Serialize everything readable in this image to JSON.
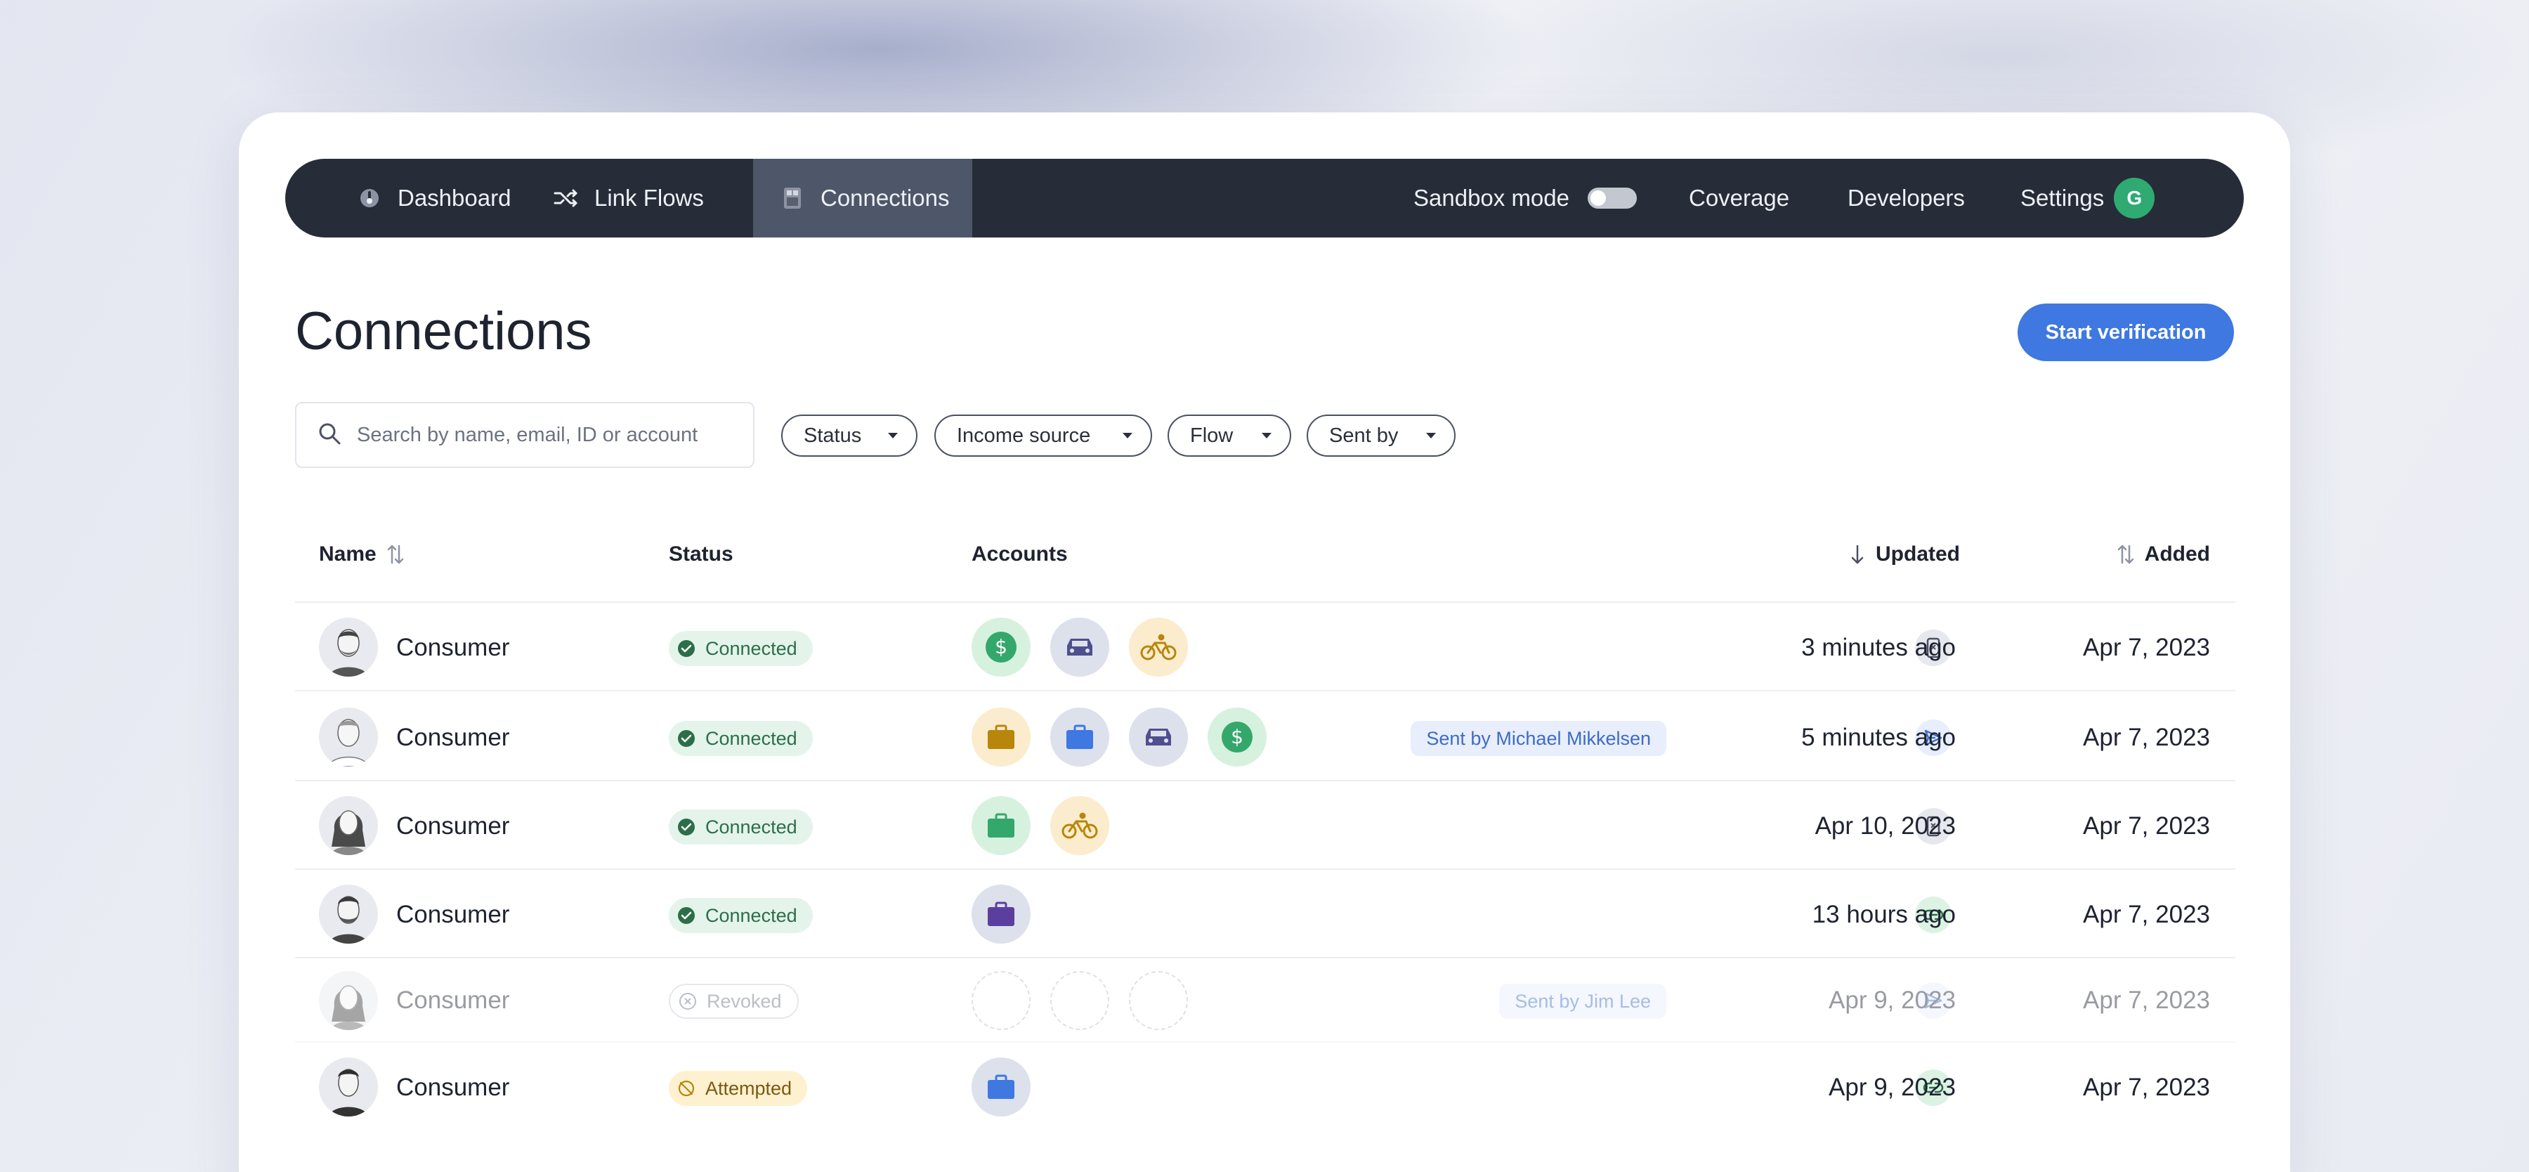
{
  "nav": {
    "dashboard": "Dashboard",
    "link_flows": "Link Flows",
    "connections": "Connections",
    "sandbox": "Sandbox mode",
    "coverage": "Coverage",
    "developers": "Developers",
    "settings": "Settings",
    "avatar_initial": "G"
  },
  "page": {
    "title": "Connections",
    "start_button": "Start verification"
  },
  "search": {
    "placeholder": "Search by name, email, ID or account"
  },
  "filters": {
    "status": "Status",
    "income_source": "Income source",
    "flow": "Flow",
    "sent_by": "Sent by"
  },
  "table": {
    "headers": {
      "name": "Name",
      "status": "Status",
      "accounts": "Accounts",
      "updated": "Updated",
      "added": "Added"
    },
    "rows": [
      {
        "name": "Consumer",
        "status": "Connected",
        "accounts": [
          "dollar-icon",
          "car-icon",
          "bike-icon"
        ],
        "sent_by": "",
        "method": "phone-icon",
        "updated": "3 minutes ago",
        "added": "Apr 7, 2023"
      },
      {
        "name": "Consumer",
        "status": "Connected",
        "accounts": [
          "briefcase-icon",
          "briefcase-icon",
          "car-icon",
          "dollar-icon"
        ],
        "sent_by": "Sent by Michael Mikkelsen",
        "method": "send-icon",
        "updated": "5 minutes ago",
        "added": "Apr 7, 2023"
      },
      {
        "name": "Consumer",
        "status": "Connected",
        "accounts": [
          "briefcase-icon",
          "bike-icon"
        ],
        "sent_by": "",
        "method": "phone-icon",
        "updated": "Apr 10, 2023",
        "added": "Apr 7, 2023"
      },
      {
        "name": "Consumer",
        "status": "Connected",
        "accounts": [
          "briefcase-icon"
        ],
        "sent_by": "",
        "method": "link-icon",
        "updated": "13 hours ago",
        "added": "Apr 7, 2023"
      },
      {
        "name": "Consumer",
        "status": "Revoked",
        "accounts": [
          "empty",
          "empty",
          "empty"
        ],
        "sent_by": "Sent by Jim Lee",
        "method": "send-icon",
        "updated": "Apr 9, 2023",
        "added": "Apr 7, 2023"
      },
      {
        "name": "Consumer",
        "status": "Attempted",
        "accounts": [
          "briefcase-icon"
        ],
        "sent_by": "",
        "method": "link-icon",
        "updated": "Apr 9, 2023",
        "added": "Apr 7, 2023"
      }
    ]
  },
  "colors": {
    "nav_bg": "#262c38",
    "nav_active": "#4d5769",
    "accent": "#3e78e0",
    "connected": "#2c6e49",
    "attempted": "#7a5a10"
  }
}
